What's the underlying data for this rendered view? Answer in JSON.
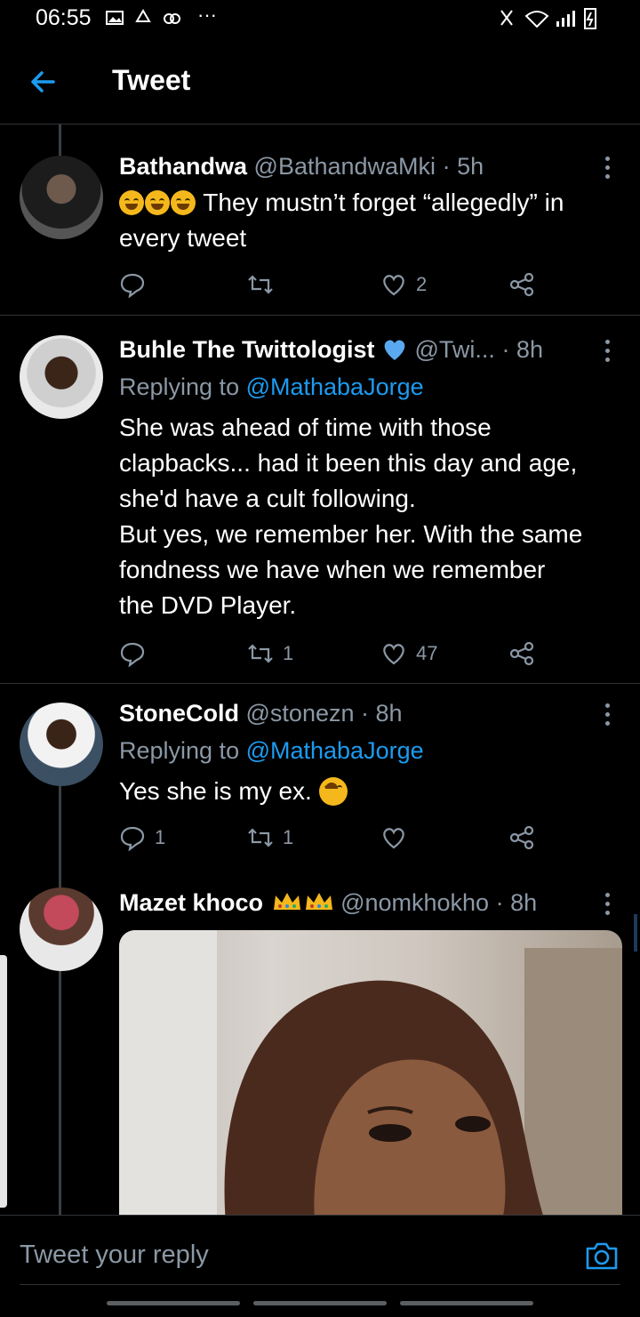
{
  "status": {
    "time": "06:55",
    "more": "···"
  },
  "header": {
    "title": "Tweet"
  },
  "tweets": [
    {
      "name": "Bathandwa",
      "handle": "@BathandwaMki",
      "time": "· 5h",
      "text": " They mustn’t forget “allegedly” in every tweet",
      "reply_count": "",
      "retweet_count": "",
      "like_count": "2"
    },
    {
      "name": "Buhle The Twittologist",
      "handle": "@Twi...",
      "time": "· 8h",
      "replying_label": "Replying to ",
      "replying_to": "@MathabaJorge",
      "text_lines": [
        "She was ahead of time with those",
        "clapbacks... had it been this day and age,",
        "she'd have a cult following.",
        "But yes, we remember her. With the same",
        "fondness we have when we remember",
        "the DVD Player."
      ],
      "reply_count": "",
      "retweet_count": "1",
      "like_count": "47"
    },
    {
      "name": "StoneCold",
      "handle": "@stonezn",
      "time": "· 8h",
      "replying_label": "Replying to ",
      "replying_to": "@MathabaJorge",
      "text": "Yes she is my ex.",
      "reply_count": "1",
      "retweet_count": "1",
      "like_count": ""
    },
    {
      "name": "Mazet khoco",
      "handle": "@nomkhokho",
      "time": "· 8h"
    }
  ],
  "reply_bar": {
    "placeholder": "Tweet your reply"
  },
  "colors": {
    "accent": "#1d9bf0",
    "muted": "#8b98a5",
    "background": "#000000"
  }
}
